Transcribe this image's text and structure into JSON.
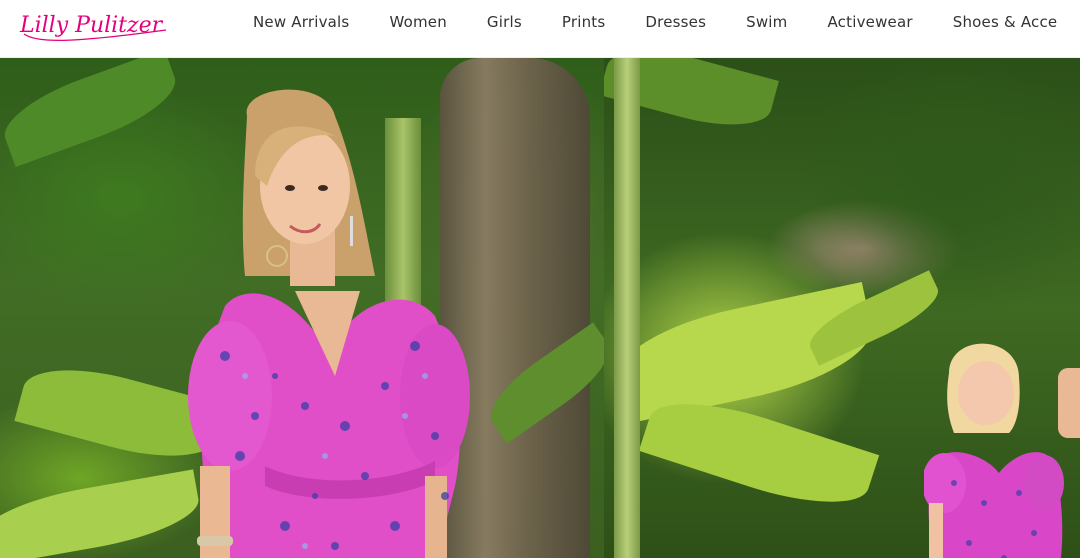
{
  "brand": {
    "name": "Lilly Pulitzer",
    "accent": "#e4007c"
  },
  "nav": {
    "items": [
      {
        "label": "New Arrivals"
      },
      {
        "label": "Women"
      },
      {
        "label": "Girls"
      },
      {
        "label": "Prints"
      },
      {
        "label": "Dresses"
      },
      {
        "label": "Swim"
      },
      {
        "label": "Activewear"
      },
      {
        "label": "Shoes & Acce"
      }
    ]
  },
  "hero": {
    "left_panel": {
      "subject": "woman in pink print puff-sleeve dress",
      "dress_color": "#e04fc8"
    },
    "right_panel": {
      "subject": "girl in pink print dress",
      "dress_color": "#d946c8"
    }
  }
}
